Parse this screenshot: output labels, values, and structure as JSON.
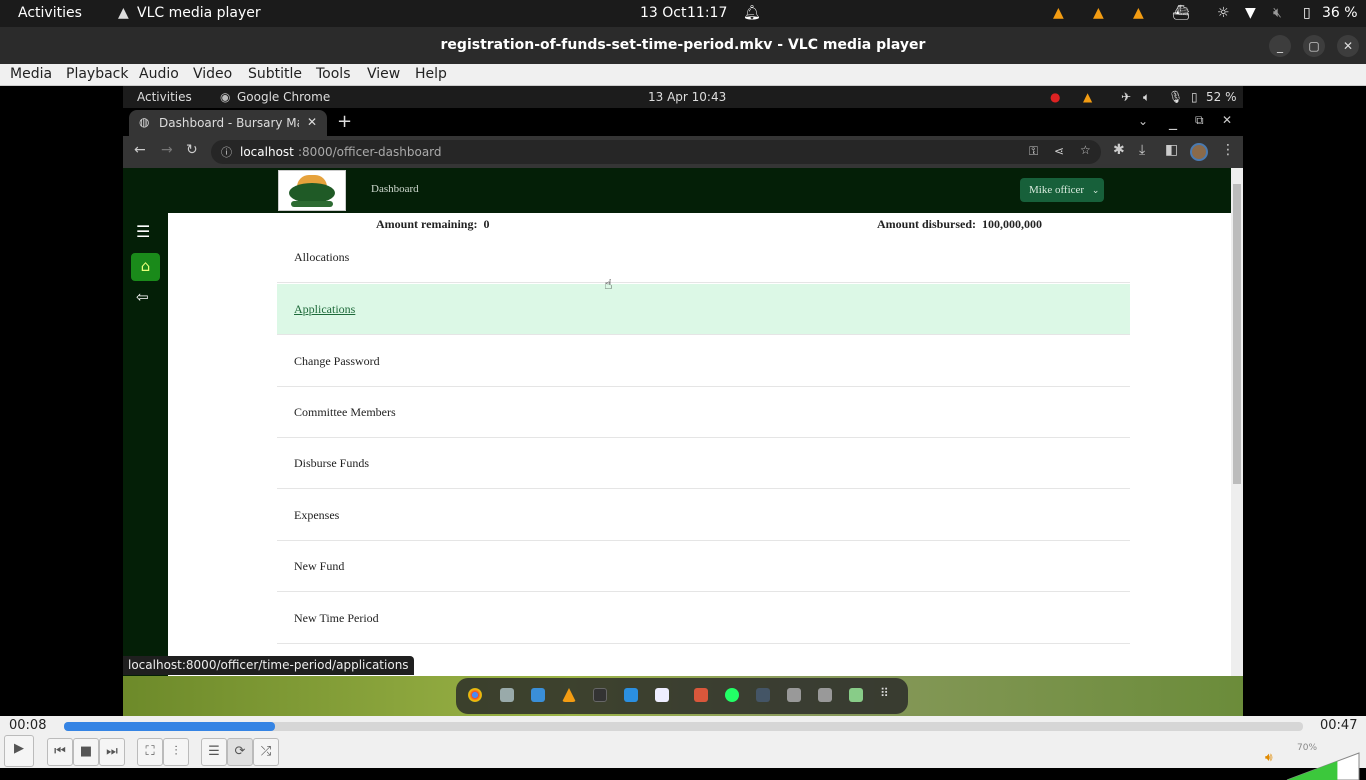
{
  "os_top_bar": {
    "activities": "Activities",
    "app_name": "VLC media player",
    "date": "13 Oct",
    "time": "11:17",
    "battery": "36 %"
  },
  "vlc": {
    "window_title": "registration-of-funds-set-time-period.mkv - VLC media player",
    "menu": [
      "Media",
      "Playback",
      "Audio",
      "Video",
      "Subtitle",
      "Tools",
      "View",
      "Help"
    ],
    "elapsed": "00:08",
    "total": "00:47",
    "progress_fraction": 0.17,
    "volume": "70%",
    "volume_fraction": 0.7
  },
  "inner_os_bar": {
    "activities": "Activities",
    "app_name": "Google Chrome",
    "datetime": "13 Apr  10:43",
    "battery": "52 %"
  },
  "browser": {
    "tab_title": "Dashboard - Bursary Mana",
    "url_host": "localhost",
    "url_path": ":8000/officer-dashboard",
    "status_url": "localhost:8000/officer/time-period/applications"
  },
  "app": {
    "nav_dashboard": "Dashboard",
    "user_menu": "Mike officer",
    "amount_remaining_label": "Amount remaining:",
    "amount_remaining_value": "0",
    "amount_disbursed_label": "Amount disbursed:",
    "amount_disbursed_value": "100,000,000",
    "menu_items": [
      {
        "label": "Allocations"
      },
      {
        "label": "Applications",
        "active": true
      },
      {
        "label": "Change Password"
      },
      {
        "label": "Committee Members"
      },
      {
        "label": "Disburse Funds"
      },
      {
        "label": "Expenses"
      },
      {
        "label": "New Fund"
      },
      {
        "label": "New Time Period"
      }
    ]
  },
  "icons": {
    "play": "▶",
    "prev": "⏮",
    "stop": "■",
    "next": "⏭",
    "fullscreen": "⛶",
    "eq": "⫶",
    "playlist": "☰",
    "loop": "⟳",
    "shuffle": "⤮"
  }
}
